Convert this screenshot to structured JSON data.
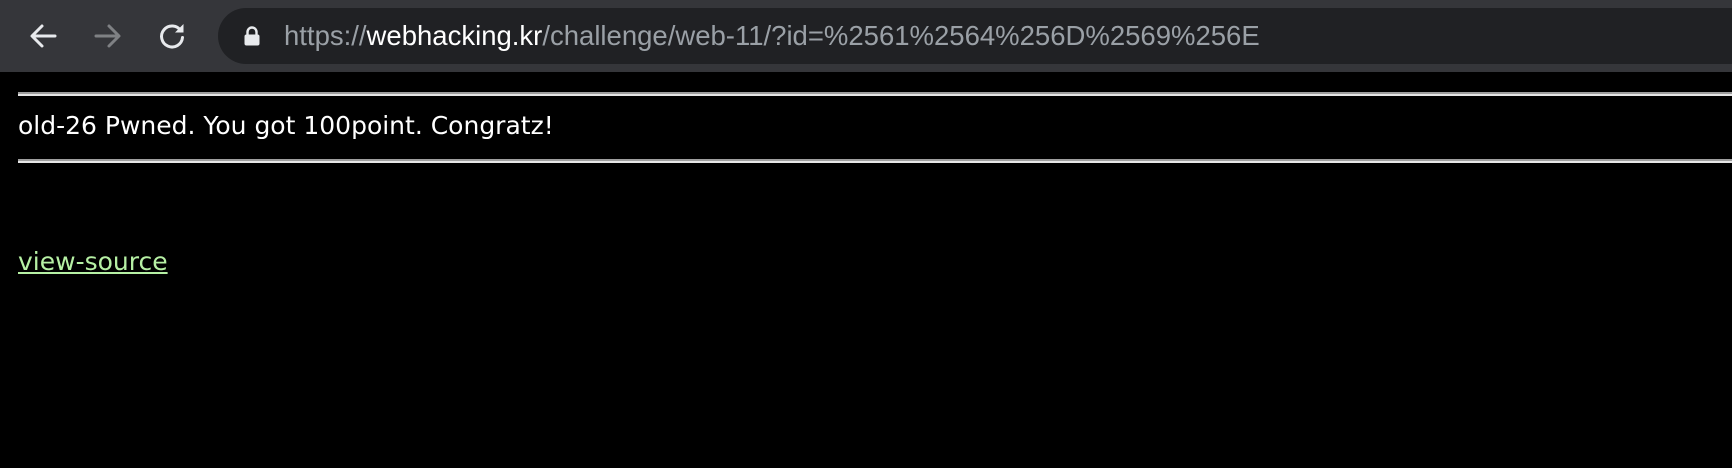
{
  "browser": {
    "url_scheme": "https://",
    "url_host": "webhacking.kr",
    "url_path": "/challenge/web-11/?id=%2561%2564%256D%2569%256E",
    "icons": {
      "back": "arrow-left-icon",
      "forward": "arrow-right-icon",
      "reload": "reload-icon",
      "lock": "lock-icon"
    },
    "colors": {
      "toolbar": "#35363a",
      "omnibox": "#202124",
      "url_dim": "#9aa0a6",
      "url_host": "#ffffff"
    }
  },
  "page": {
    "message": "old-26 Pwned. You got 100point. Congratz!",
    "view_source_label": "view-source",
    "colors": {
      "background": "#000000",
      "text": "#ffffff",
      "link": "#b6f0a4"
    }
  }
}
